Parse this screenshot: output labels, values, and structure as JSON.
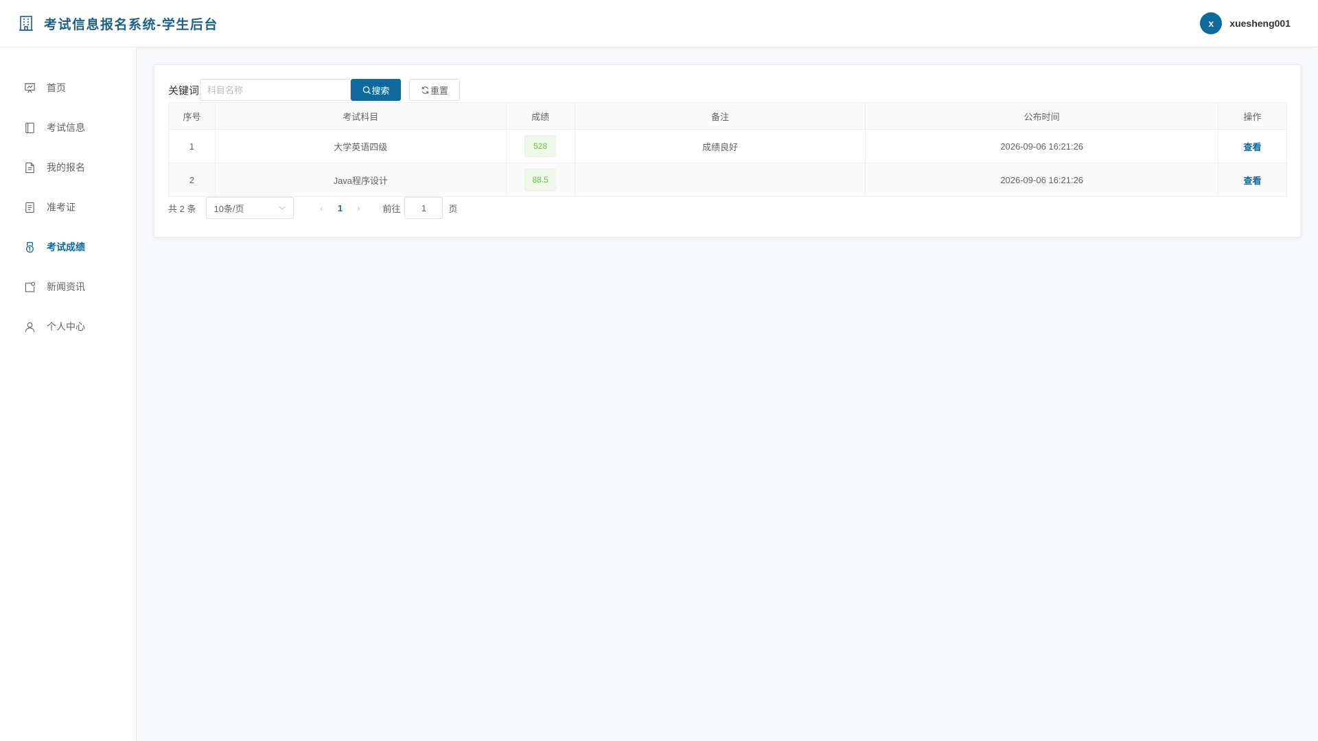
{
  "header": {
    "title": "考试信息报名系统-学生后台",
    "avatar_letter": "x",
    "username": "xuesheng001"
  },
  "sidebar": {
    "items": [
      {
        "label": "首页",
        "icon": "presentation-icon",
        "active": false
      },
      {
        "label": "考试信息",
        "icon": "notebook-icon",
        "active": false
      },
      {
        "label": "我的报名",
        "icon": "document-icon",
        "active": false
      },
      {
        "label": "准考证",
        "icon": "tickets-icon",
        "active": false
      },
      {
        "label": "考试成绩",
        "icon": "medal-icon",
        "active": true
      },
      {
        "label": "新闻资讯",
        "icon": "news-icon",
        "active": false
      },
      {
        "label": "个人中心",
        "icon": "user-icon",
        "active": false
      }
    ]
  },
  "search": {
    "label": "关键词",
    "placeholder": "科目名称",
    "value": "",
    "search_button": "搜索",
    "reset_button": "重置"
  },
  "table": {
    "columns": [
      "序号",
      "考试科目",
      "成绩",
      "备注",
      "公布时间",
      "操作"
    ],
    "rows": [
      {
        "index": "1",
        "subject": "大学英语四级",
        "score": "528",
        "remark": "成绩良好",
        "published": "2026-09-06 16:21:26",
        "action": "查看"
      },
      {
        "index": "2",
        "subject": "Java程序设计",
        "score": "88.5",
        "remark": "",
        "published": "2026-09-06 16:21:26",
        "action": "查看"
      }
    ]
  },
  "pagination": {
    "total_text": "共 2 条",
    "page_size": "10条/页",
    "current_page": "1",
    "goto_label": "前往",
    "goto_value": "1",
    "goto_suffix": "页"
  },
  "colors": {
    "primary": "#0e6a9c",
    "brand_title": "#1f5f86",
    "success_text": "#67c23a",
    "success_bg": "#f0f9eb"
  }
}
